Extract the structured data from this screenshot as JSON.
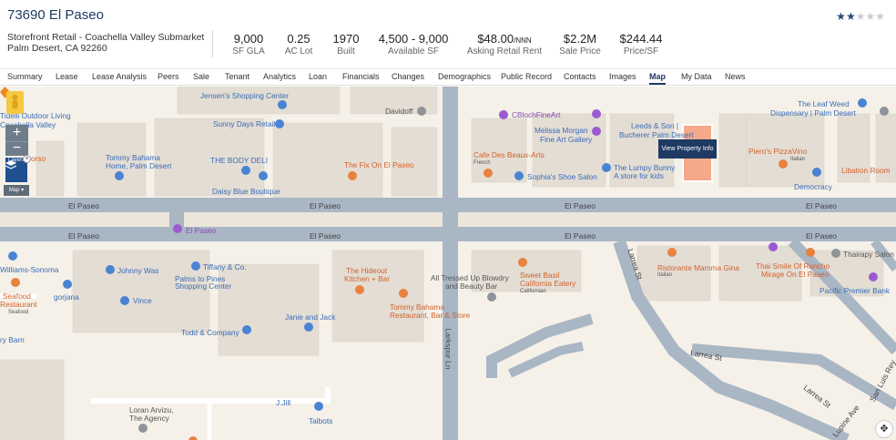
{
  "property": {
    "title": "73690 El Paseo",
    "subtitle1": "Storefront Retail - Coachella Valley Submarket",
    "subtitle2": "Palm Desert, CA 92260",
    "stars_filled": 2,
    "stars_total": 5
  },
  "stats": [
    {
      "value": "9,000",
      "unit": "",
      "label": "SF GLA"
    },
    {
      "value": "0.25",
      "unit": "",
      "label": "AC Lot"
    },
    {
      "value": "1970",
      "unit": "",
      "label": "Built"
    },
    {
      "value": "4,500 - 9,000",
      "unit": "",
      "label": "Available SF"
    },
    {
      "value": "$48.00",
      "unit": "/NNN",
      "label": "Asking Retail Rent"
    },
    {
      "value": "$2.2M",
      "unit": "",
      "label": "Sale Price"
    },
    {
      "value": "$244.44",
      "unit": "",
      "label": "Price/SF"
    }
  ],
  "tabs": [
    "Summary",
    "Lease",
    "Lease Analysis",
    "Peers",
    "Sale",
    "Tenant",
    "Analytics",
    "Loan",
    "Financials",
    "Changes",
    "Demographics",
    "Public Record",
    "Contacts",
    "Images",
    "Map",
    "My Data",
    "News"
  ],
  "active_tab": "Map",
  "map": {
    "layers_label": "Layers",
    "map_toggle_label": "Map",
    "tooltip": "View Property Info",
    "roads": [
      "El Paseo",
      "El Paseo",
      "El Paseo",
      "El Paseo",
      "El Paseo",
      "El Paseo",
      "El Paseo",
      "El Paseo",
      "Larrea St",
      "Larrea St",
      "Larrea St",
      "Larkspur Ln",
      "San Luis Rey",
      "Lupine Ave"
    ],
    "pois": [
      {
        "text": "Jensen's Shopping Center",
        "color": "blue"
      },
      {
        "text": "Sunny Days Retail",
        "color": "blue"
      },
      {
        "text": "Davidoff",
        "color": "gray"
      },
      {
        "text": "CBlochFineArt",
        "color": "purple"
      },
      {
        "text": "The Leaf Weed",
        "color": "blue"
      },
      {
        "text": "Dispensary | Palm Desert",
        "color": "blue"
      },
      {
        "text": "Tidelli Outdoor Living",
        "color": "blue"
      },
      {
        "text": "Coachella Valley",
        "color": "blue"
      },
      {
        "text": "Melissa Morgan",
        "color": "blue"
      },
      {
        "text": "Fine Art Gallery",
        "color": "blue"
      },
      {
        "text": "Leeds & Son |",
        "color": "blue"
      },
      {
        "text": "Bucherer Palm Desert",
        "color": "blue"
      },
      {
        "text": "Tommy Bahama",
        "color": "blue"
      },
      {
        "text": "Home, Palm Desert",
        "color": "blue"
      },
      {
        "text": "THE BODY DELI",
        "color": "blue"
      },
      {
        "text": "The Fix On El Paseo",
        "color": "orange"
      },
      {
        "text": "Cafe Des Beaux-Arts",
        "color": "orange"
      },
      {
        "text": "French",
        "color": "gray"
      },
      {
        "text": "Sophia's Shoe Salon",
        "color": "blue"
      },
      {
        "text": "The Lumpy Bunny",
        "color": "blue"
      },
      {
        "text": "A store for kids",
        "color": "blue"
      },
      {
        "text": "Piero's PizzaVino",
        "color": "orange"
      },
      {
        "text": "Italian",
        "color": "gray"
      },
      {
        "text": "Libation Room",
        "color": "orange"
      },
      {
        "text": "Democracy",
        "color": "blue"
      },
      {
        "text": "Daisy Blue Boutique",
        "color": "blue"
      },
      {
        "text": "orso",
        "color": "orange"
      },
      {
        "text": "El Paseo",
        "color": "purple"
      },
      {
        "text": "Thairapy Salon El Paseo",
        "color": "gray"
      },
      {
        "text": "Williams-Sonoma",
        "color": "blue"
      },
      {
        "text": "Johnny Was",
        "color": "blue"
      },
      {
        "text": "Tiffany & Co.",
        "color": "blue"
      },
      {
        "text": "Palms to Pines",
        "color": "blue"
      },
      {
        "text": "Shopping Center",
        "color": "blue"
      },
      {
        "text": "The Hideout",
        "color": "orange"
      },
      {
        "text": "Kitchen + Bar",
        "color": "orange"
      },
      {
        "text": "All Tressed Up Blowdry",
        "color": "gray"
      },
      {
        "text": "and Beauty Bar",
        "color": "gray"
      },
      {
        "text": "Sweet Basil",
        "color": "orange"
      },
      {
        "text": "California Eatery",
        "color": "orange"
      },
      {
        "text": "Californian",
        "color": "gray"
      },
      {
        "text": "Ristorante Mamma Gina",
        "color": "orange"
      },
      {
        "text": "Italian",
        "color": "gray"
      },
      {
        "text": "Thai Smile Of Rancho",
        "color": "orange"
      },
      {
        "text": "Mirage On El Paseo",
        "color": "orange"
      },
      {
        "text": "Pacific Premier Bank",
        "color": "blue"
      },
      {
        "text": "Seafood",
        "color": "orange"
      },
      {
        "text": "Restaurant",
        "color": "orange"
      },
      {
        "text": "Seafood",
        "color": "gray"
      },
      {
        "text": "gorjana",
        "color": "blue"
      },
      {
        "text": "Vince",
        "color": "blue"
      },
      {
        "text": "Tommy Bahama",
        "color": "orange"
      },
      {
        "text": "Restaurant, Bar & Store",
        "color": "orange"
      },
      {
        "text": "Janie and Jack",
        "color": "blue"
      },
      {
        "text": "Todd & Company",
        "color": "blue"
      },
      {
        "text": "ry Barn",
        "color": "blue"
      },
      {
        "text": "J.Jill",
        "color": "blue"
      },
      {
        "text": "Talbots",
        "color": "blue"
      },
      {
        "text": "Loran Arvizu,",
        "color": "gray"
      },
      {
        "text": "The Agency",
        "color": "gray"
      }
    ]
  }
}
